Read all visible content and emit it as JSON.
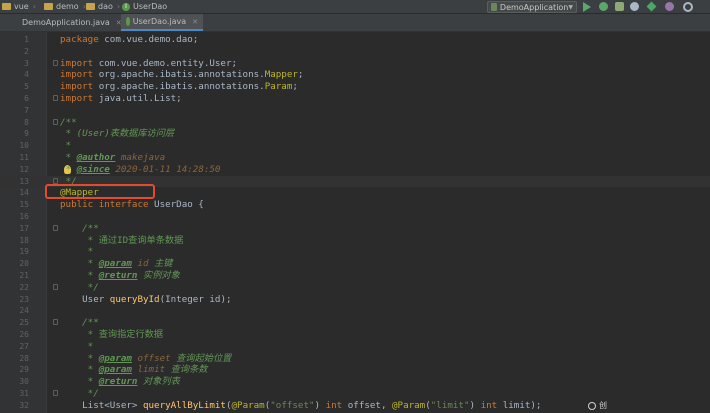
{
  "navbar": {
    "breadcrumbs": [
      "vue",
      "demo",
      "dao",
      "UserDao"
    ],
    "run_config": "DemoApplication"
  },
  "tabs": [
    {
      "label": "DemoApplication.java",
      "active": false
    },
    {
      "label": "UserDao.java",
      "active": true
    }
  ],
  "editor": {
    "lines": [
      {
        "n": "1",
        "text": "package com.vue.demo.dao;"
      },
      {
        "n": "2",
        "text": ""
      },
      {
        "n": "3",
        "text": "import com.vue.demo.entity.User;"
      },
      {
        "n": "4",
        "text": "import org.apache.ibatis.annotations.Mapper;"
      },
      {
        "n": "5",
        "text": "import org.apache.ibatis.annotations.Param;"
      },
      {
        "n": "6",
        "text": "import java.util.List;"
      },
      {
        "n": "7",
        "text": ""
      },
      {
        "n": "8",
        "text": "/**"
      },
      {
        "n": "9",
        "text": " * (User)表数据库访问层"
      },
      {
        "n": "10",
        "text": " *"
      },
      {
        "n": "11",
        "text": " * @author makejava"
      },
      {
        "n": "12",
        "text": " * @since 2020-01-11 14:28:50"
      },
      {
        "n": "13",
        "text": " */"
      },
      {
        "n": "14",
        "text": "@Mapper"
      },
      {
        "n": "15",
        "text": "public interface UserDao {"
      },
      {
        "n": "16",
        "text": ""
      },
      {
        "n": "17",
        "text": "    /**"
      },
      {
        "n": "18",
        "text": "     * 通过ID查询单条数据"
      },
      {
        "n": "19",
        "text": "     *"
      },
      {
        "n": "20",
        "text": "     * @param id 主键"
      },
      {
        "n": "21",
        "text": "     * @return 实例对象"
      },
      {
        "n": "22",
        "text": "     */"
      },
      {
        "n": "23",
        "text": "    User queryById(Integer id);"
      },
      {
        "n": "24",
        "text": ""
      },
      {
        "n": "25",
        "text": "    /**"
      },
      {
        "n": "26",
        "text": "     * 查询指定行数据"
      },
      {
        "n": "27",
        "text": "     *"
      },
      {
        "n": "28",
        "text": "     * @param offset 查询起始位置"
      },
      {
        "n": "29",
        "text": "     * @param limit 查询条数"
      },
      {
        "n": "30",
        "text": "     * @return 对象列表"
      },
      {
        "n": "31",
        "text": "     */"
      },
      {
        "n": "32",
        "text": "    List<User> queryAllByLimit(@Param(\"offset\") int offset, @Param(\"limit\") int limit);"
      }
    ]
  },
  "watermark": "创"
}
